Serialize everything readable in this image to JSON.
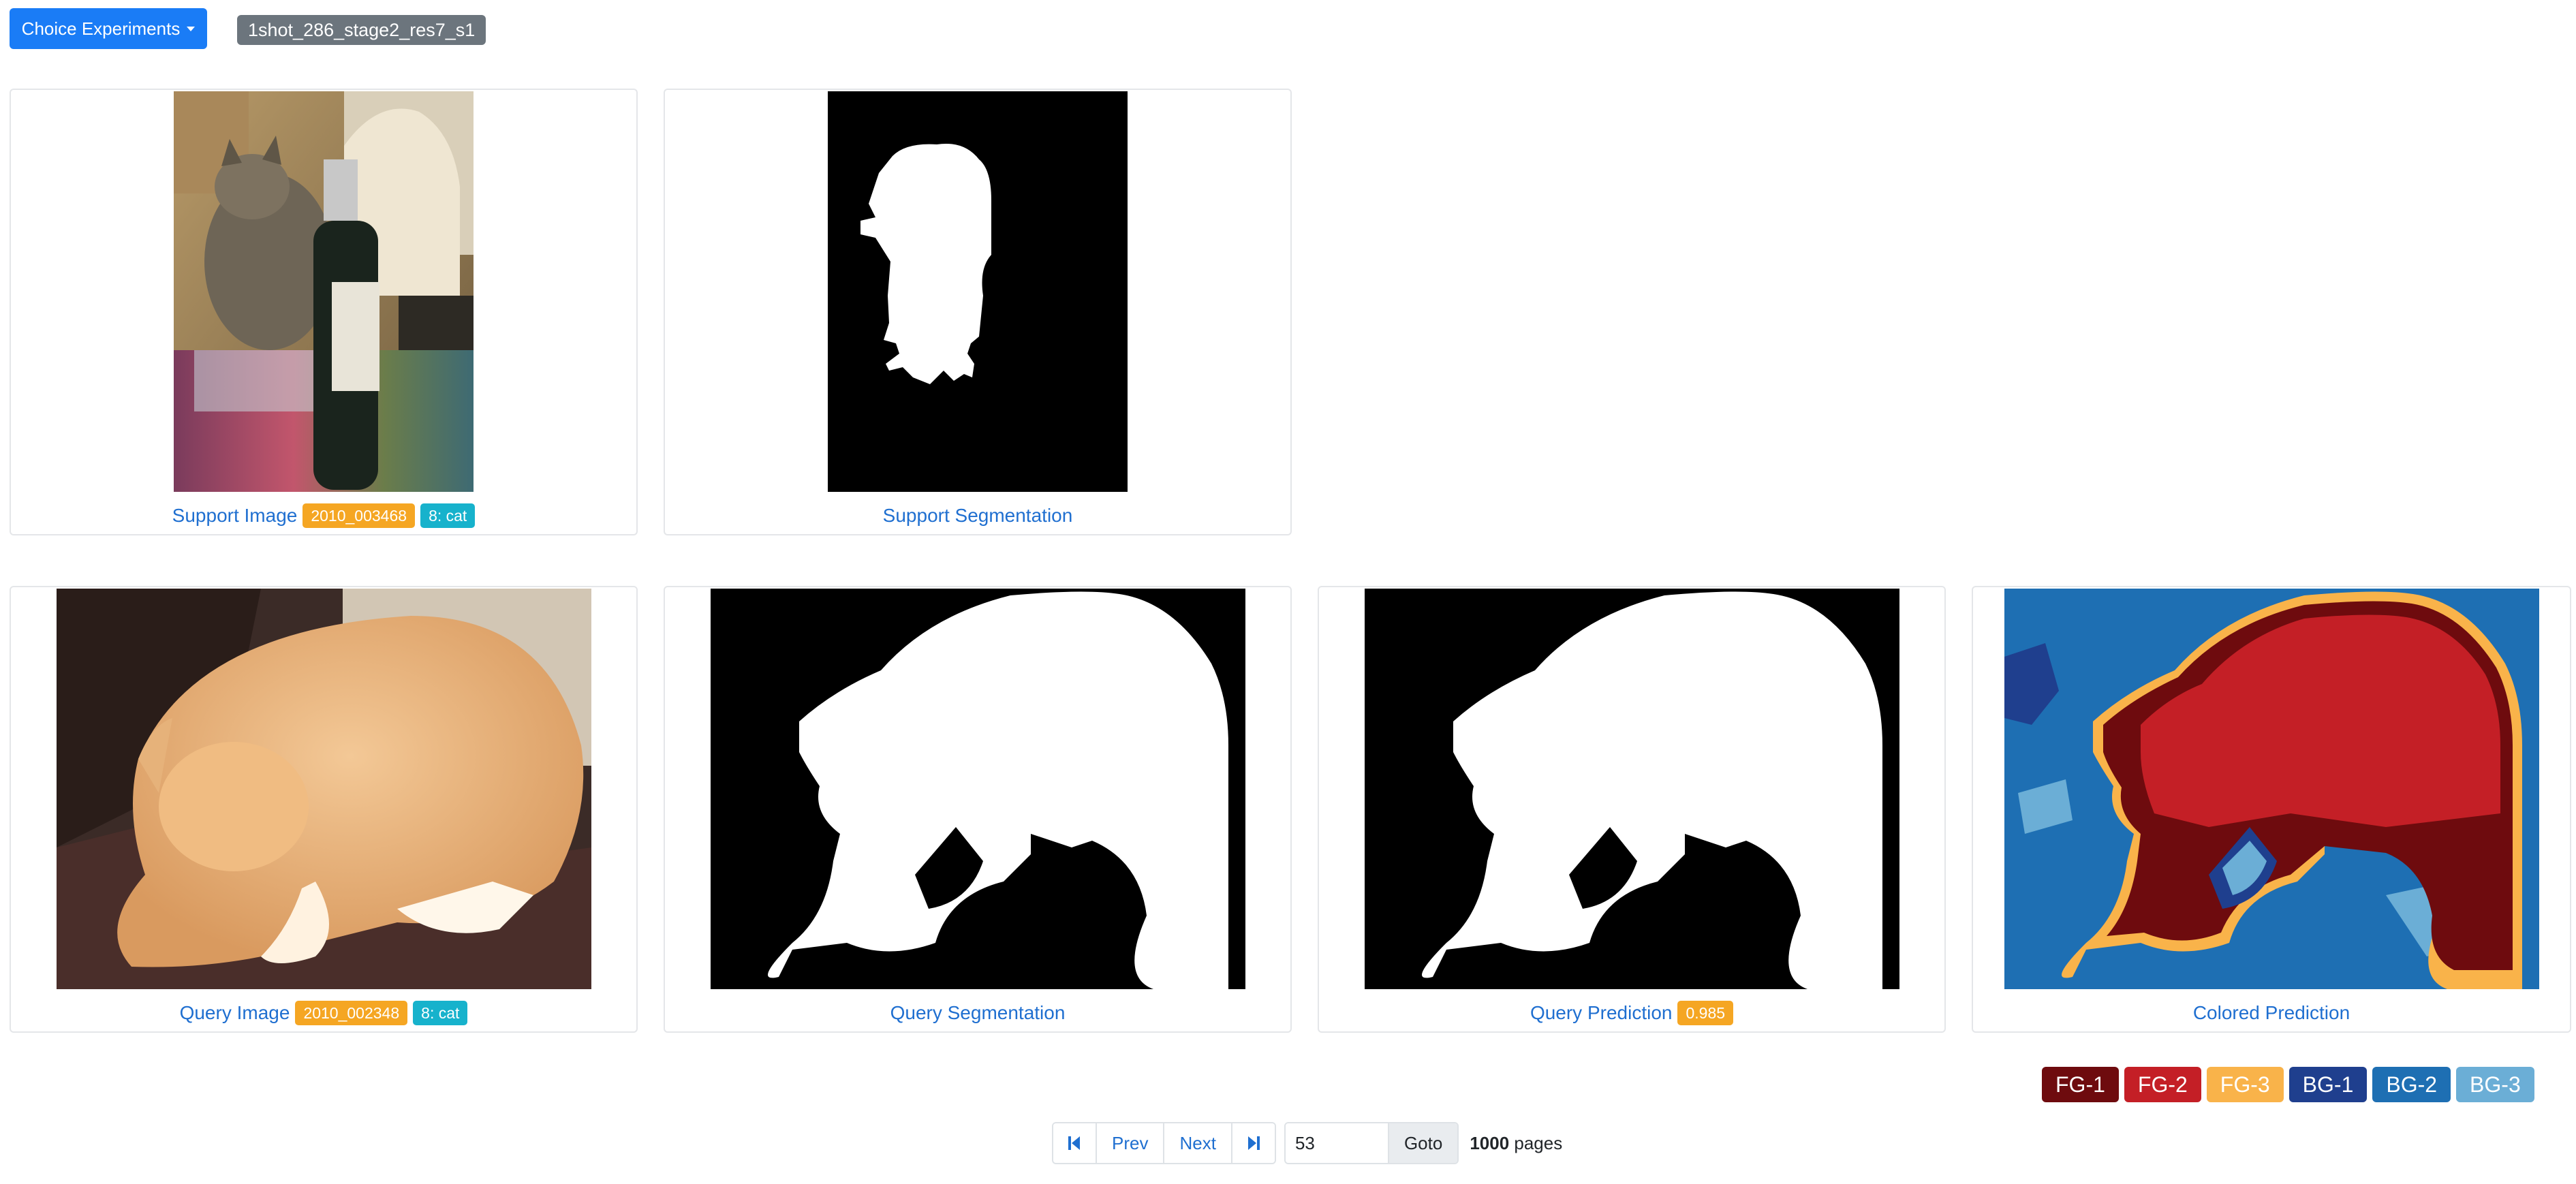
{
  "header": {
    "dropdown_label": "Choice Experiments",
    "experiment_tag": "1shot_286_stage2_res7_s1"
  },
  "support": {
    "image_label": "Support Image",
    "image_id": "2010_003468",
    "class_tag": "8: cat",
    "segmentation_label": "Support Segmentation"
  },
  "query": {
    "image_label": "Query Image",
    "image_id": "2010_002348",
    "class_tag": "8: cat",
    "segmentation_label": "Query Segmentation",
    "prediction_label": "Query Prediction",
    "prediction_score": "0.985",
    "colored_label": "Colored Prediction"
  },
  "legend": [
    {
      "label": "FG-1",
      "color": "#6e0b0e"
    },
    {
      "label": "FG-2",
      "color": "#c41f26"
    },
    {
      "label": "FG-3",
      "color": "#f9b34a"
    },
    {
      "label": "BG-1",
      "color": "#1f3f8e"
    },
    {
      "label": "BG-2",
      "color": "#1e6fb3"
    },
    {
      "label": "BG-3",
      "color": "#6baed6"
    }
  ],
  "pagination": {
    "prev": "Prev",
    "next": "Next",
    "page_value": "53",
    "goto": "Goto",
    "total": "1000",
    "pages_suffix": "pages"
  }
}
